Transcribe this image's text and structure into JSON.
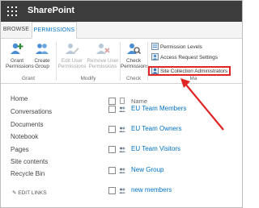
{
  "suite_bar": {
    "title": "SharePoint"
  },
  "tabs": [
    {
      "label": "BROWSE"
    },
    {
      "label": "PERMISSIONS"
    }
  ],
  "ribbon": {
    "grant": {
      "group_label": "Grant",
      "buttons": [
        {
          "label_1": "Grant",
          "label_2": "Permissions"
        },
        {
          "label_1": "Create",
          "label_2": "Group"
        }
      ]
    },
    "modify": {
      "group_label": "Modify",
      "buttons": [
        {
          "label_1": "Edit User",
          "label_2": "Permissions"
        },
        {
          "label_1": "Remove User",
          "label_2": "Permissions"
        }
      ]
    },
    "check": {
      "group_label": "Check",
      "buttons": [
        {
          "label_1": "Check",
          "label_2": "Permissions"
        }
      ]
    },
    "manage": {
      "group_label": "Ma",
      "items": [
        {
          "label": "Permission Levels"
        },
        {
          "label": "Access Request Settings"
        },
        {
          "label": "Site Collection Administrators"
        }
      ]
    }
  },
  "left_nav": {
    "items": [
      "Home",
      "Conversations",
      "Documents",
      "Notebook",
      "Pages",
      "Site contents",
      "Recycle Bin"
    ],
    "edit_links": "EDIT LINKS"
  },
  "list": {
    "header": "Name",
    "rows": [
      "EU Team Members",
      "EU Team Owners",
      "EU Team Visitors",
      "New Group",
      "new members"
    ]
  },
  "colors": {
    "suite_bar": "#3c3c3c",
    "accent": "#0072c6",
    "highlight": "#e02424"
  }
}
